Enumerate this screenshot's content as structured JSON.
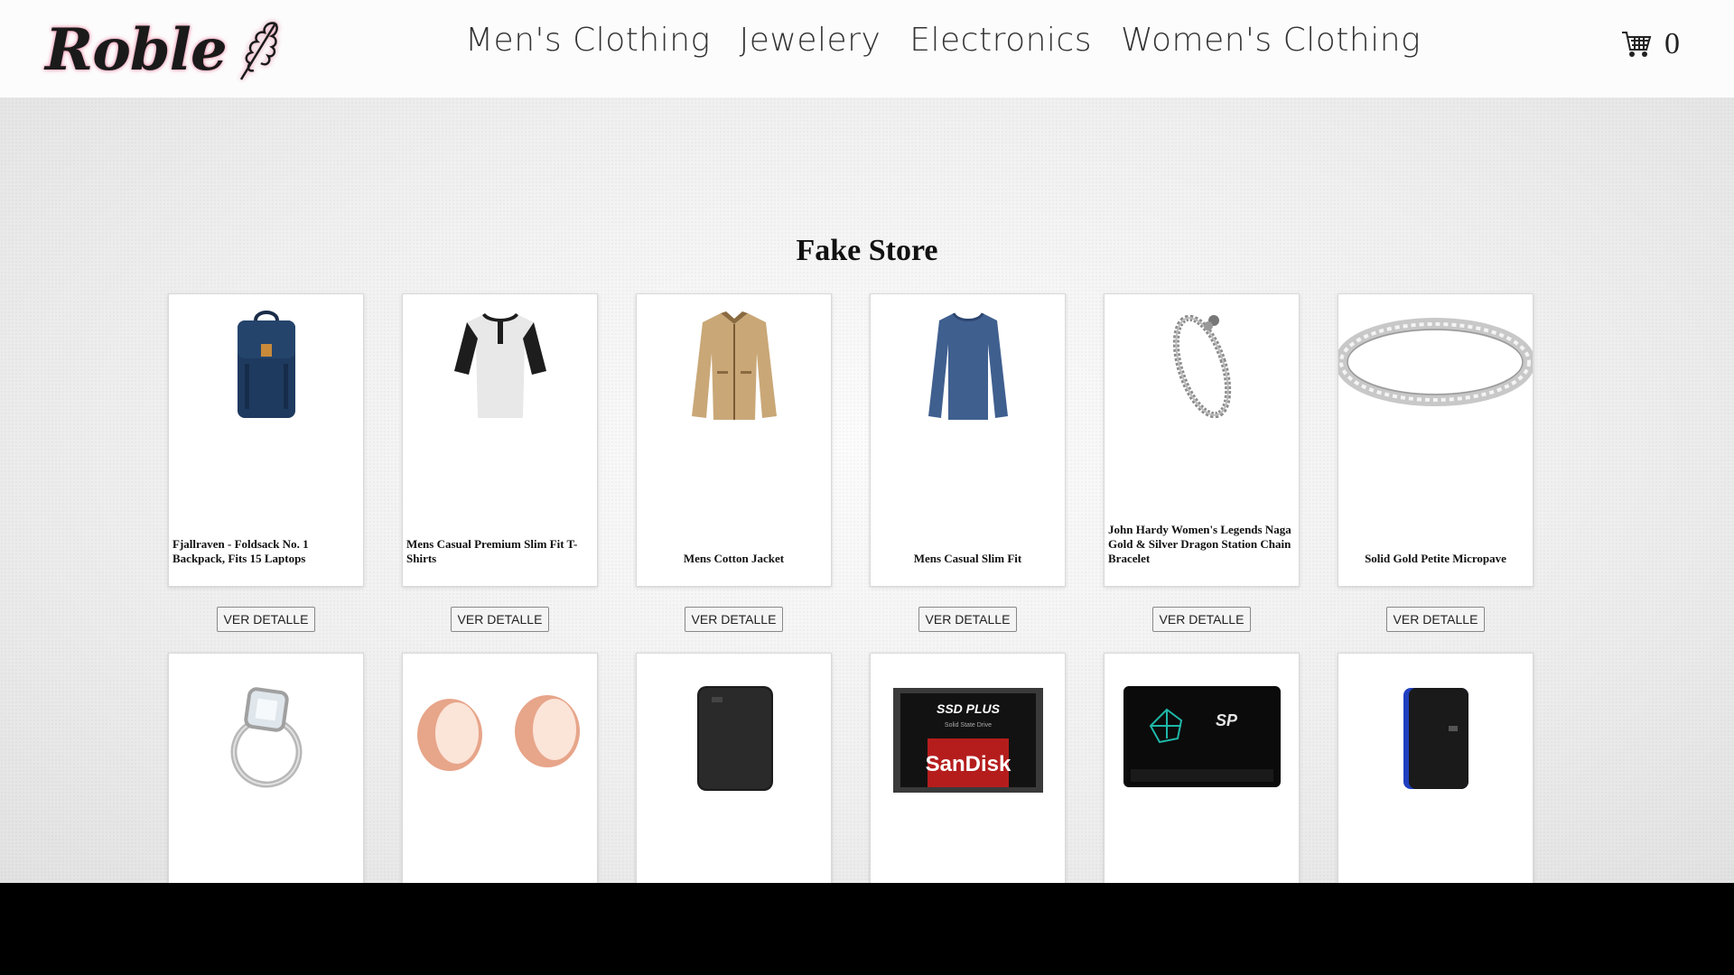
{
  "header": {
    "logo_text": "Roble",
    "nav": [
      "Men's Clothing",
      "Jewelery",
      "Electronics",
      "Women's Clothing"
    ],
    "cart_count": "0"
  },
  "main": {
    "title": "Fake Store",
    "button_label": "VER DETALLE",
    "products": [
      {
        "title": "Fjallraven - Foldsack No. 1 Backpack, Fits 15 Laptops",
        "image": "backpack"
      },
      {
        "title": "Mens Casual Premium Slim Fit T-Shirts",
        "image": "henley-shirt"
      },
      {
        "title": "Mens Cotton Jacket",
        "image": "jacket"
      },
      {
        "title": "Mens Casual Slim Fit",
        "image": "long-sleeve-shirt"
      },
      {
        "title": "John Hardy Women's Legends Naga Gold & Silver Dragon Station Chain Bracelet",
        "image": "chain-bracelet"
      },
      {
        "title": "Solid Gold Petite Micropave",
        "image": "bangle"
      }
    ],
    "products_row2": [
      {
        "image": "diamond-ring"
      },
      {
        "image": "rose-gold-plugs"
      },
      {
        "image": "external-hard-drive"
      },
      {
        "image": "ssd",
        "label_top": "SSD PLUS",
        "label_small": "Solid State Drive",
        "brand": "SanDisk"
      },
      {
        "image": "ssd-sp",
        "brand": "SP"
      },
      {
        "image": "portable-drive"
      }
    ]
  },
  "colors": {
    "logo_glow": "#e88aa7",
    "nav_text": "#333333",
    "backpack": "#1f3a5f",
    "jacket": "#c9a777",
    "shirt_blue": "#3f5f8f"
  }
}
